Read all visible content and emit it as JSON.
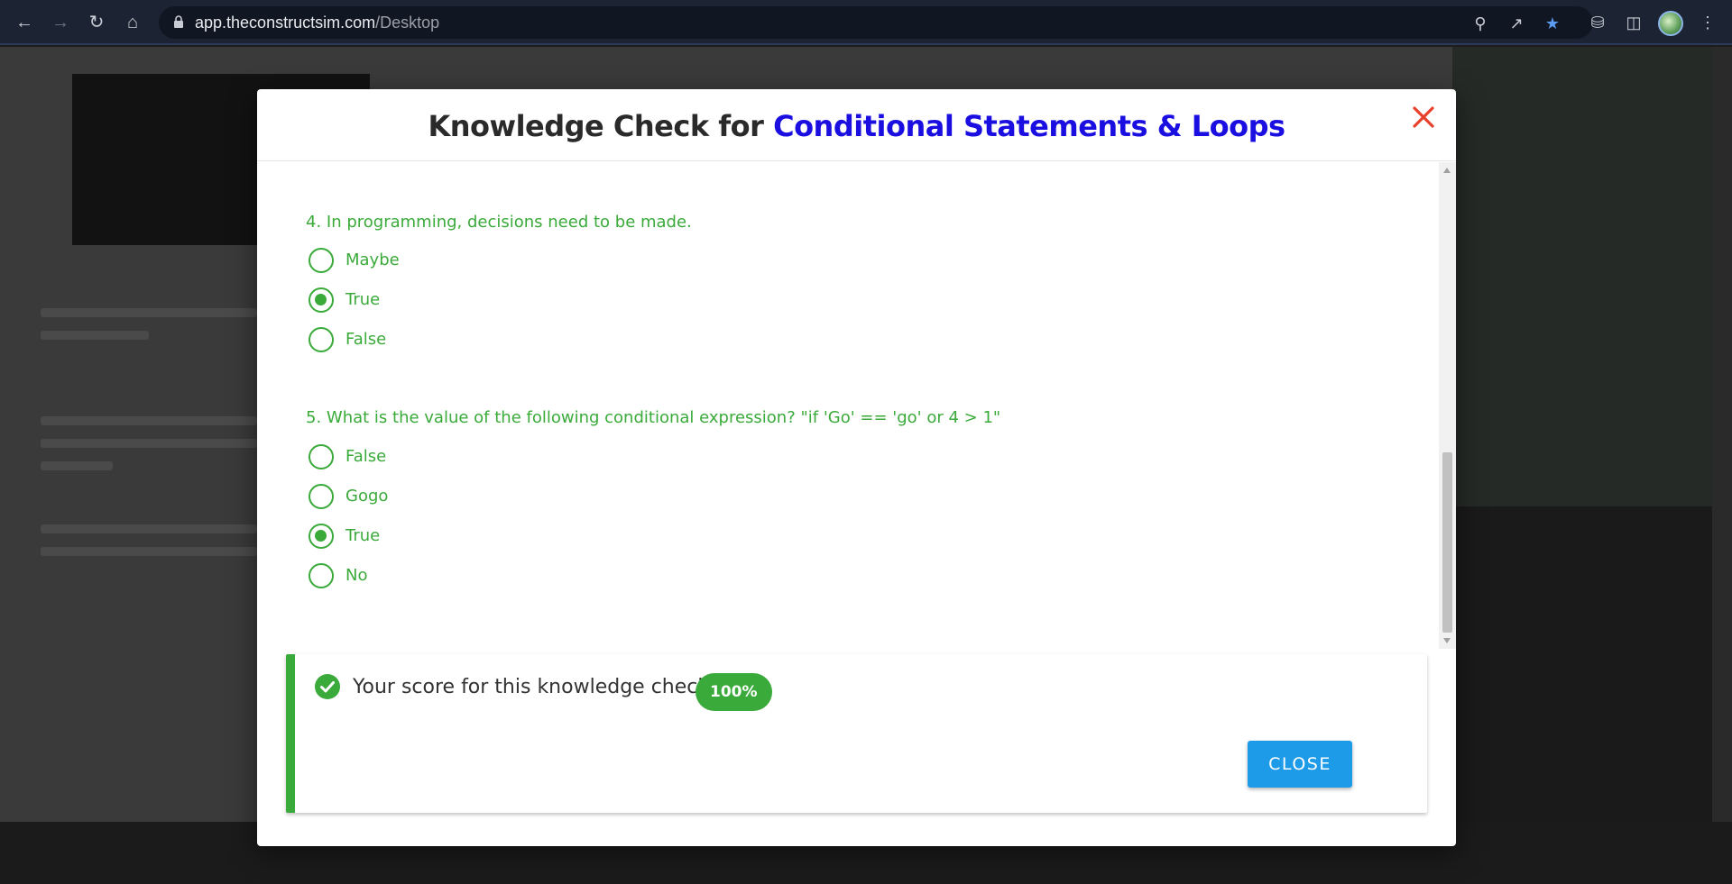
{
  "browser": {
    "url_host": "app.theconstructsim.com",
    "url_path": "/Desktop"
  },
  "modal": {
    "title_prefix": "Knowledge Check for ",
    "title_topic": "Conditional Statements & Loops"
  },
  "questions": [
    {
      "text": "4. In programming, decisions need to be made.",
      "options": [
        {
          "label": "Maybe",
          "selected": false
        },
        {
          "label": "True",
          "selected": true
        },
        {
          "label": "False",
          "selected": false
        }
      ]
    },
    {
      "text": "5. What is the value of the following conditional expression? \"if 'Go' == 'go' or 4 > 1\"",
      "options": [
        {
          "label": "False",
          "selected": false
        },
        {
          "label": "Gogo",
          "selected": false
        },
        {
          "label": "True",
          "selected": true
        },
        {
          "label": "No",
          "selected": false
        }
      ]
    }
  ],
  "score": {
    "text": "Your score for this knowledge check:",
    "value": "100%"
  },
  "buttons": {
    "close_label": "CLOSE"
  },
  "colors": {
    "accent_green": "#3aaa3a",
    "title_blue": "#1a0fe0",
    "close_red": "#e8402a",
    "button_blue": "#1e9be8"
  }
}
